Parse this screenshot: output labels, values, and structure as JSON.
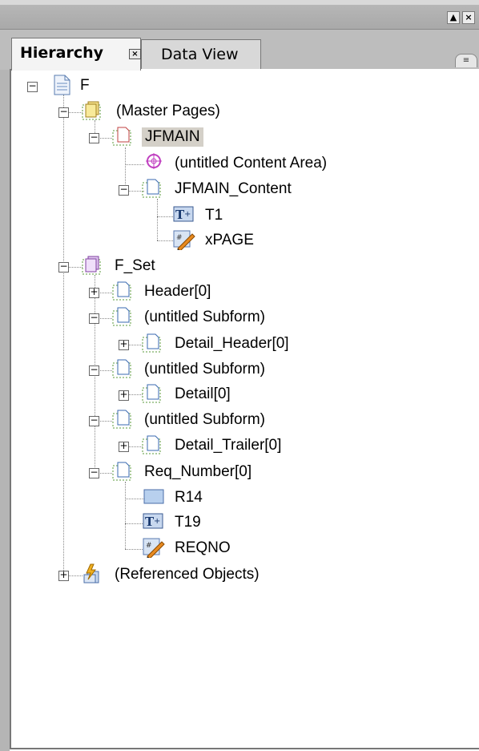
{
  "window": {
    "minimize_glyph": "▲",
    "close_glyph": "×"
  },
  "tabs": {
    "hierarchy_label": "Hierarchy",
    "hierarchy_close": "×",
    "dataview_label": "Data View",
    "menu_glyph": "≡"
  },
  "tree": {
    "root": "F",
    "master_pages": "(Master Pages)",
    "jfmain": "JFMAIN",
    "content_area": "(untitled Content Area)",
    "jfmain_content": "JFMAIN_Content",
    "t1": "T1",
    "xpage": "xPAGE",
    "f_set": "F_Set",
    "header": "Header[0]",
    "subform_1": "(untitled Subform)",
    "detail_header": "Detail_Header[0]",
    "subform_2": "(untitled Subform)",
    "detail": "Detail[0]",
    "subform_3": "(untitled Subform)",
    "detail_trailer": "Detail_Trailer[0]",
    "req_number": "Req_Number[0]",
    "r14": "R14",
    "t19": "T19",
    "reqno": "REQNO",
    "referenced_objects": "(Referenced Objects)"
  },
  "toggles": {
    "expanded": "−",
    "collapsed": "+"
  },
  "icons": [
    "document-icon",
    "master-pages-icon",
    "page-icon",
    "content-area-icon",
    "subform-icon",
    "text-field-icon",
    "script-field-icon",
    "subform-set-icon",
    "rectangle-icon",
    "referenced-objects-icon"
  ]
}
